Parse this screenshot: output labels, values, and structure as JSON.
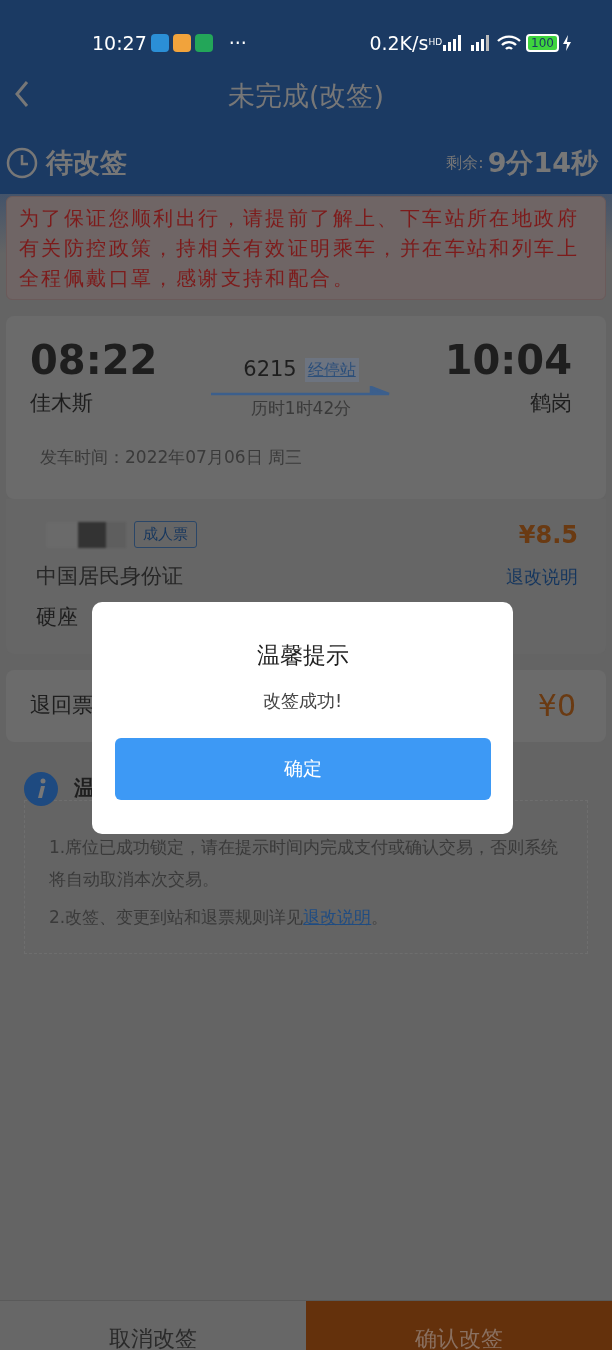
{
  "status_bar": {
    "time": "10:27",
    "more": "···",
    "network_speed": "0.2K/s",
    "hd_label": "HD",
    "battery": "100"
  },
  "header": {
    "title": "未完成(改签)"
  },
  "status": {
    "label": "待改签",
    "remaining_label": "剩余:",
    "remaining": "9分14秒"
  },
  "notice": "为了保证您顺利出行，请提前了解上、下车站所在地政府有关防控政策，持相关有效证明乘车，并在车站和列车上全程佩戴口罩，感谢支持和配合。",
  "trip": {
    "depart_time": "08:22",
    "depart_station": "佳木斯",
    "train_no": "6215",
    "stops_link": "经停站",
    "duration": "历时1时42分",
    "arrive_time": "10:04",
    "arrive_station": "鹤岗",
    "date": "发车时间：2022年07月06日 周三"
  },
  "passenger": {
    "ticket_type": "成人票",
    "price": "¥8.5",
    "id_type": "中国居民身份证",
    "refund_link": "退改说明",
    "seat": "硬座"
  },
  "refund": {
    "label": "退回票",
    "amount": "¥0"
  },
  "tips": {
    "title": "温",
    "items": [
      {
        "text": "1.席位已成功锁定，请在提示时间内完成支付或确认交易，否则系统将自动取消本次交易。"
      },
      {
        "text": "2.改签、变更到站和退票规则详见",
        "link": "退改说明",
        "end": "。"
      }
    ]
  },
  "dialog": {
    "title": "温馨提示",
    "message": "改签成功!",
    "ok_button": "确定"
  },
  "bottom_bar": {
    "cancel": "取消改签",
    "confirm": "确认改签"
  }
}
